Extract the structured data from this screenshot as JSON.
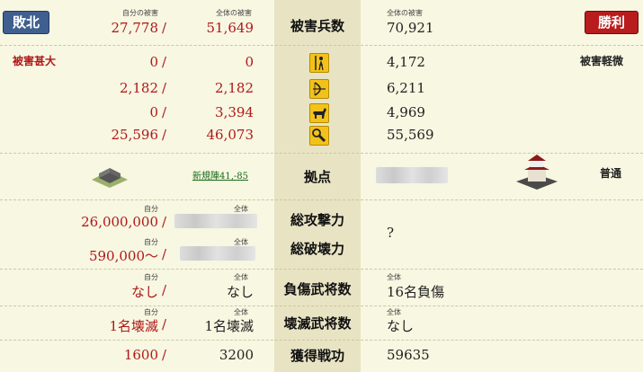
{
  "header": {
    "defeat_label": "敗北",
    "victory_label": "勝利",
    "own_damage_label": "自分の被害",
    "total_damage_label": "全体の被害",
    "own_damage_value": "27,778",
    "total_damage_value": "51,649",
    "center_title": "被害兵数",
    "enemy_total_label": "全体の被害",
    "enemy_total_value": "70,921"
  },
  "left_status": "被害甚大",
  "right_status": "被害軽微",
  "unit_rows": [
    {
      "own": "0",
      "total": "0",
      "enemy": "4,172",
      "icon": "spear-icon"
    },
    {
      "own": "2,182",
      "total": "2,182",
      "enemy": "6,211",
      "icon": "bow-icon"
    },
    {
      "own": "0",
      "total": "3,394",
      "enemy": "4,969",
      "icon": "horse-icon"
    },
    {
      "own": "25,596",
      "total": "46,073",
      "enemy": "55,569",
      "icon": "siege-icon"
    }
  ],
  "base": {
    "label": "拠点",
    "own_link": "新規陣41,-85",
    "enemy_status": "普通"
  },
  "power": {
    "attack_label": "総攻撃力",
    "destroy_label": "総破壊力",
    "self_tag": "自分",
    "total_tag": "全体",
    "attack_value": "26,000,000",
    "destroy_value": "590,000～",
    "enemy_value": "?"
  },
  "injured": {
    "label": "負傷武将数",
    "self_tag": "自分",
    "total_tag": "全体",
    "own": "なし",
    "total": "なし",
    "enemy_tag": "全体",
    "enemy": "16名負傷"
  },
  "destroyed": {
    "label": "壊滅武将数",
    "self_tag": "自分",
    "total_tag": "全体",
    "own": "1名壊滅",
    "total": "1名壊滅",
    "enemy_tag": "全体",
    "enemy": "なし"
  },
  "merit": {
    "label": "獲得戦功",
    "own": "1600",
    "total": "3200",
    "enemy": "59635"
  },
  "colors": {
    "defeat_bg": "#3f5f8f",
    "victory_bg": "#b81c1c",
    "center_band": "#e8e3c3",
    "icon_yellow": "#f3c21a"
  }
}
